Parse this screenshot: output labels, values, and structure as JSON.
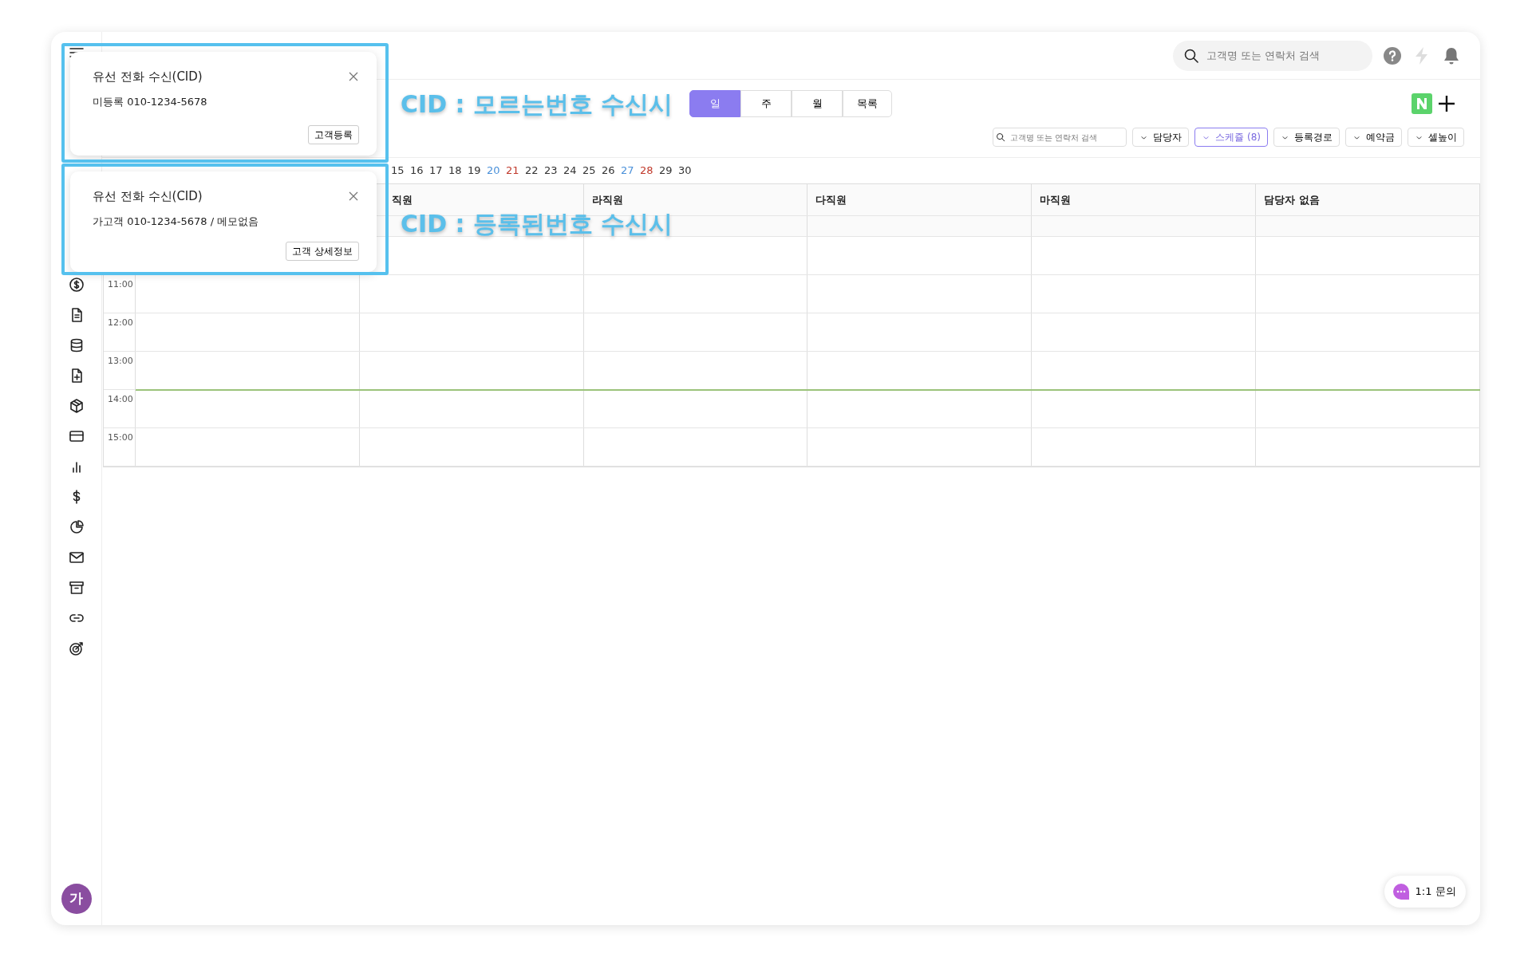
{
  "topbar": {
    "search": {
      "placeholder": "고객명 또는 연락처 검색"
    }
  },
  "view_tabs": [
    {
      "label": "일",
      "selected": true
    },
    {
      "label": "주",
      "selected": false
    },
    {
      "label": "월",
      "selected": false
    },
    {
      "label": "목록",
      "selected": false
    }
  ],
  "filters": {
    "search": {
      "placeholder": "고객명 또는 연락처 검색"
    },
    "dropdowns": [
      {
        "label": "담당자",
        "active": false
      },
      {
        "label": "스케쥴 (8)",
        "active": true
      },
      {
        "label": "등록경로",
        "active": false
      },
      {
        "label": "예약금",
        "active": false
      },
      {
        "label": "셀높이",
        "active": false
      }
    ]
  },
  "dates": [
    {
      "label": "15",
      "color": "#333333"
    },
    {
      "label": "16",
      "color": "#333333"
    },
    {
      "label": "17",
      "color": "#333333"
    },
    {
      "label": "18",
      "color": "#333333"
    },
    {
      "label": "19",
      "color": "#333333"
    },
    {
      "label": "20",
      "color": "#4a90d9"
    },
    {
      "label": "21",
      "color": "#c0392b"
    },
    {
      "label": "22",
      "color": "#333333"
    },
    {
      "label": "23",
      "color": "#333333"
    },
    {
      "label": "24",
      "color": "#333333"
    },
    {
      "label": "25",
      "color": "#333333"
    },
    {
      "label": "26",
      "color": "#333333"
    },
    {
      "label": "27",
      "color": "#4a90d9"
    },
    {
      "label": "28",
      "color": "#c0392b"
    },
    {
      "label": "29",
      "color": "#333333"
    },
    {
      "label": "30",
      "color": "#333333"
    }
  ],
  "schedule": {
    "columns": [
      "직원",
      "라직원",
      "다직원",
      "마직원",
      "담당자 없음"
    ],
    "time_slots": [
      "11:00",
      "12:00",
      "13:00",
      "14:00",
      "15:00"
    ]
  },
  "popups": [
    {
      "title": "유선 전화 수신(CID)",
      "message": "미등록 010-1234-5678",
      "button": "고객등록"
    },
    {
      "title": "유선 전화 수신(CID)",
      "message": "가고객 010-1234-5678 / 메모없음",
      "button": "고객 상세정보"
    }
  ],
  "annotations": [
    "CID : 모르는번호 수신시",
    "CID : 등록된번호 수신시"
  ],
  "avatar": {
    "initial": "가"
  },
  "chat_button": {
    "label": "1:1 문의"
  }
}
